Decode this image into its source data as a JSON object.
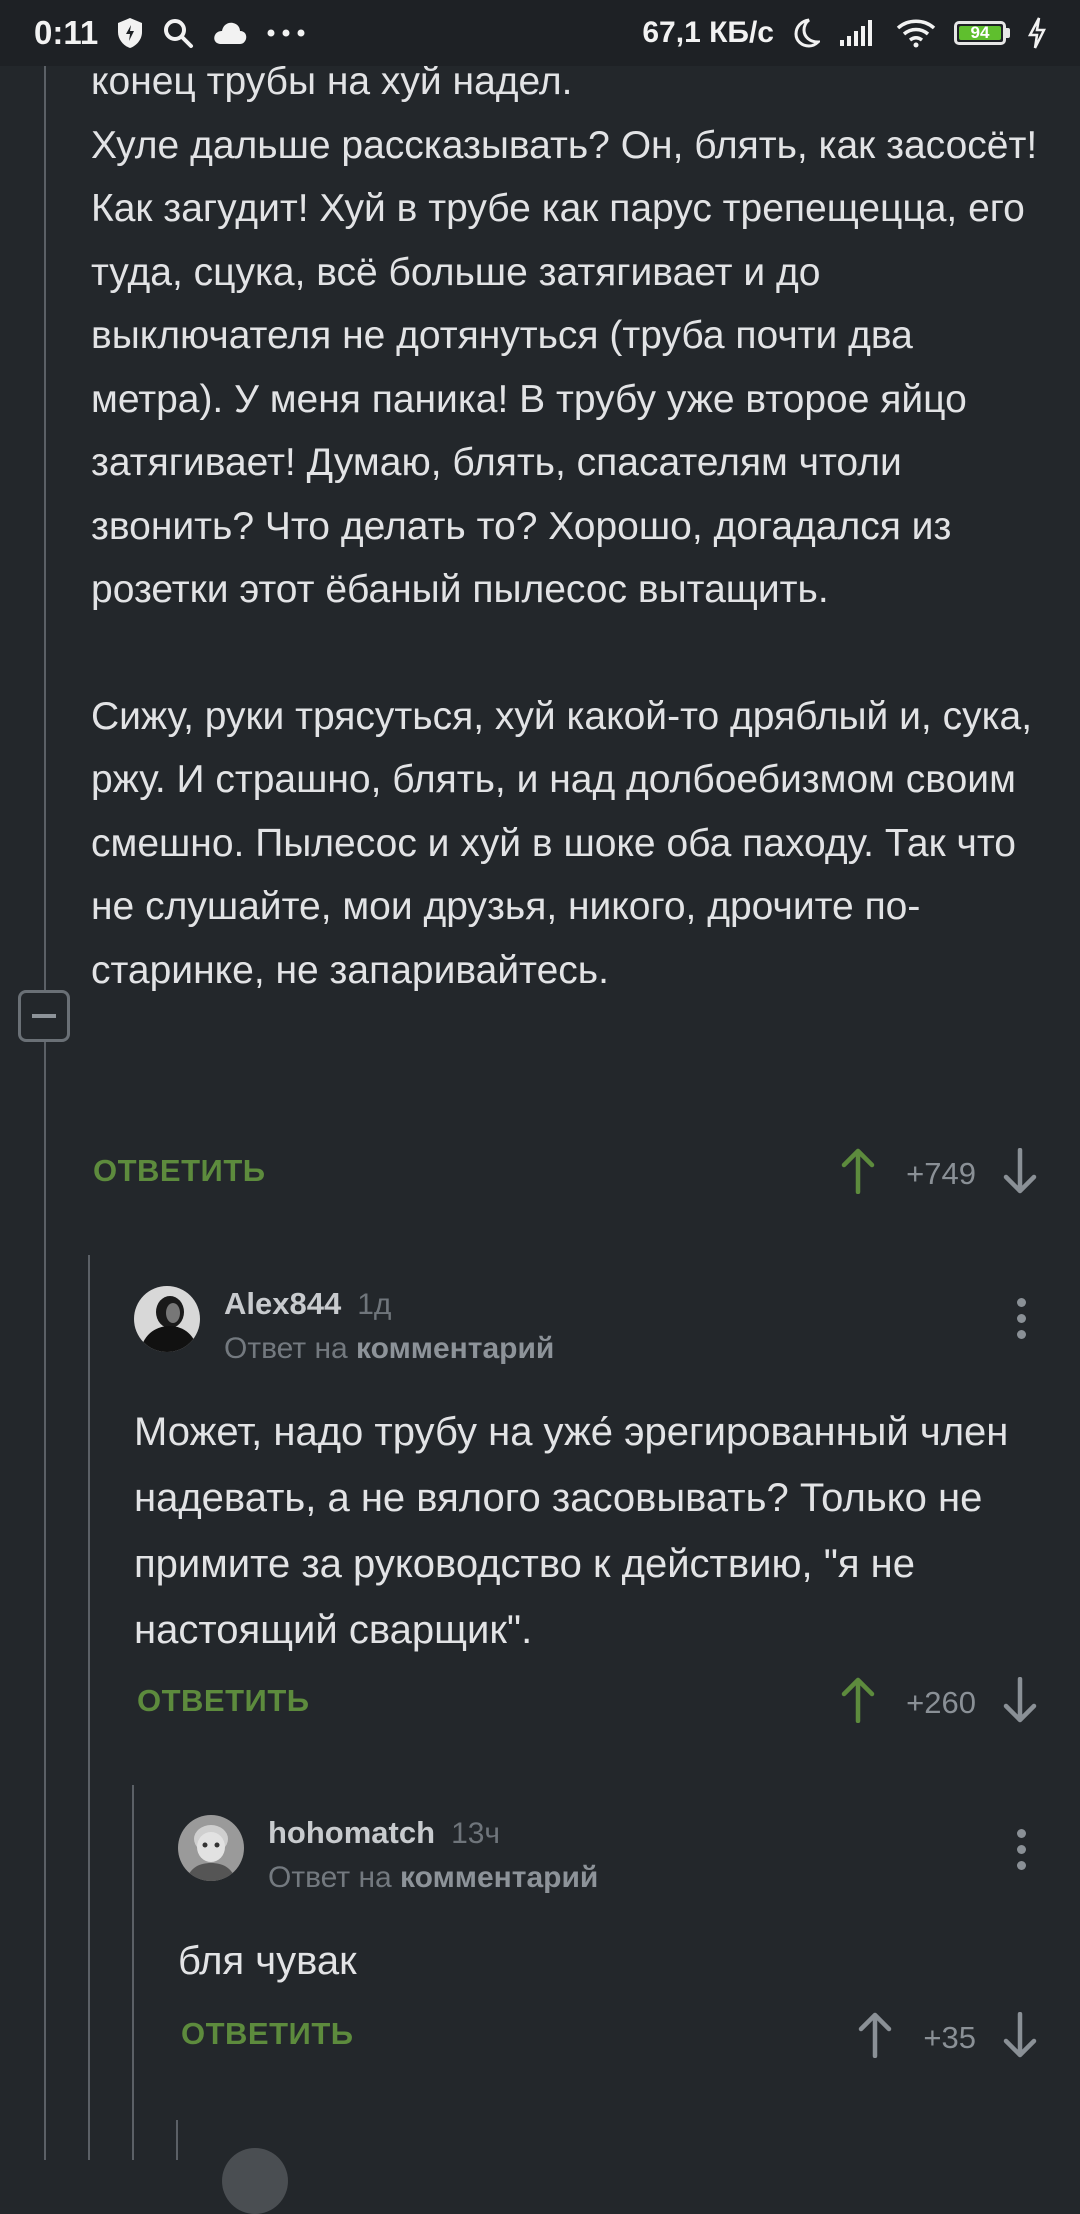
{
  "status_bar": {
    "time": "0:11",
    "network_speed": "67,1 КБ/с",
    "battery_level": "94",
    "icons": [
      "shield-icon",
      "search-icon",
      "cloud-icon",
      "more-icon",
      "moon-icon",
      "signal-icon",
      "wifi-icon",
      "battery-icon",
      "charging-icon"
    ]
  },
  "colors": {
    "background": "#23272b",
    "accent_green": "#5d8b3d",
    "upvote_active": "#5d8b3d",
    "text": "#e2e3e5"
  },
  "main_comment": {
    "paragraphs": [
      "конец трубы на хуй надел.",
      "Хуле дальше рассказывать? Он, блять, как засосёт! Как загудит! Хуй в трубе как парус трепещецца, его туда, сцука, всё больше затягивает и до выключателя не дотянуться (труба почти два метра). У меня паника! В трубу уже второе яйцо затягивает! Думаю, блять, спасателям чтоли звонить? Что делать то? Хорошо, догадался из розетки этот ёбаный пылесос вытащить.",
      "Сижу, руки трясуться, хуй какой-то дряблый и, сука, ржу. И страшно, блять, и над долбоебизмом своим смешно. Пылесос и хуй в шоке оба паходу. Так что не слушайте, мои друзья, никого, дрочите по-старинке, не запаривайтесь."
    ],
    "reply_label": "ОТВЕТИТЬ",
    "rating": "+749"
  },
  "comments": [
    {
      "author": "Alex844",
      "time": "1д",
      "reply_prefix": "Ответ на",
      "reply_target": "комментарий",
      "text": "Может, надо трубу на уже́ эрегированный член надевать, а не вялого засовывать? Только не примите за руководство к действию, \"я не настоящий сварщик\".",
      "reply_label": "ОТВЕТИТЬ",
      "rating": "+260"
    },
    {
      "author": "hohomatch",
      "time": "13ч",
      "reply_prefix": "Ответ на",
      "reply_target": "комментарий",
      "text": "бля чувак",
      "reply_label": "ОТВЕТИТЬ",
      "rating": "+35"
    }
  ]
}
